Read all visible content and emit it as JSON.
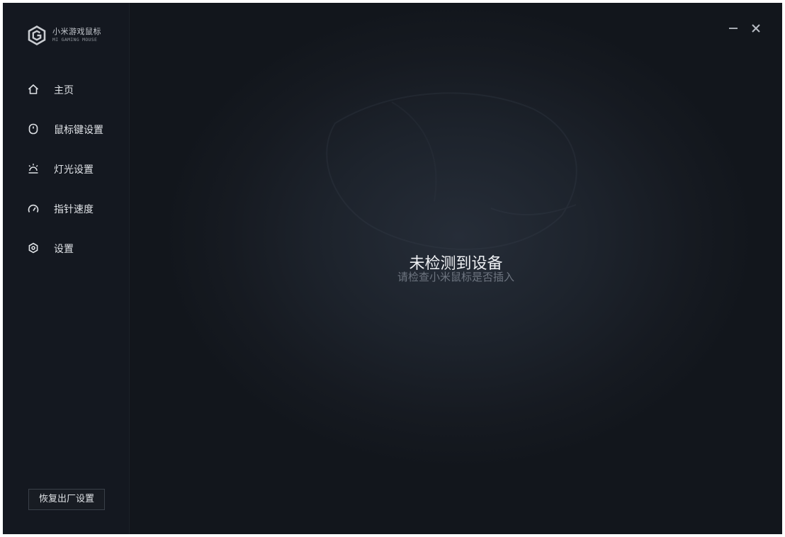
{
  "app": {
    "name_cn": "小米游戏鼠标",
    "name_en": "MI GAMING MOUSE",
    "logo_icon": "hexagon-g-logo"
  },
  "sidebar": {
    "items": [
      {
        "label": "主页",
        "icon": "home-icon"
      },
      {
        "label": "鼠标键设置",
        "icon": "mouse-icon"
      },
      {
        "label": "灯光设置",
        "icon": "light-icon"
      },
      {
        "label": "指针速度",
        "icon": "speed-gauge-icon"
      },
      {
        "label": "设置",
        "icon": "settings-icon"
      }
    ],
    "reset_label": "恢复出厂设置"
  },
  "window_controls": {
    "minimize": "minimize-icon",
    "close": "close-icon"
  },
  "main": {
    "title": "未检测到设备",
    "subtitle": "请检查小米鼠标是否插入"
  },
  "colors": {
    "sidebar_bg": "#141820",
    "main_bg": "#1d232c",
    "text_primary": "#eef0f3",
    "text_secondary": "#6e7580"
  }
}
